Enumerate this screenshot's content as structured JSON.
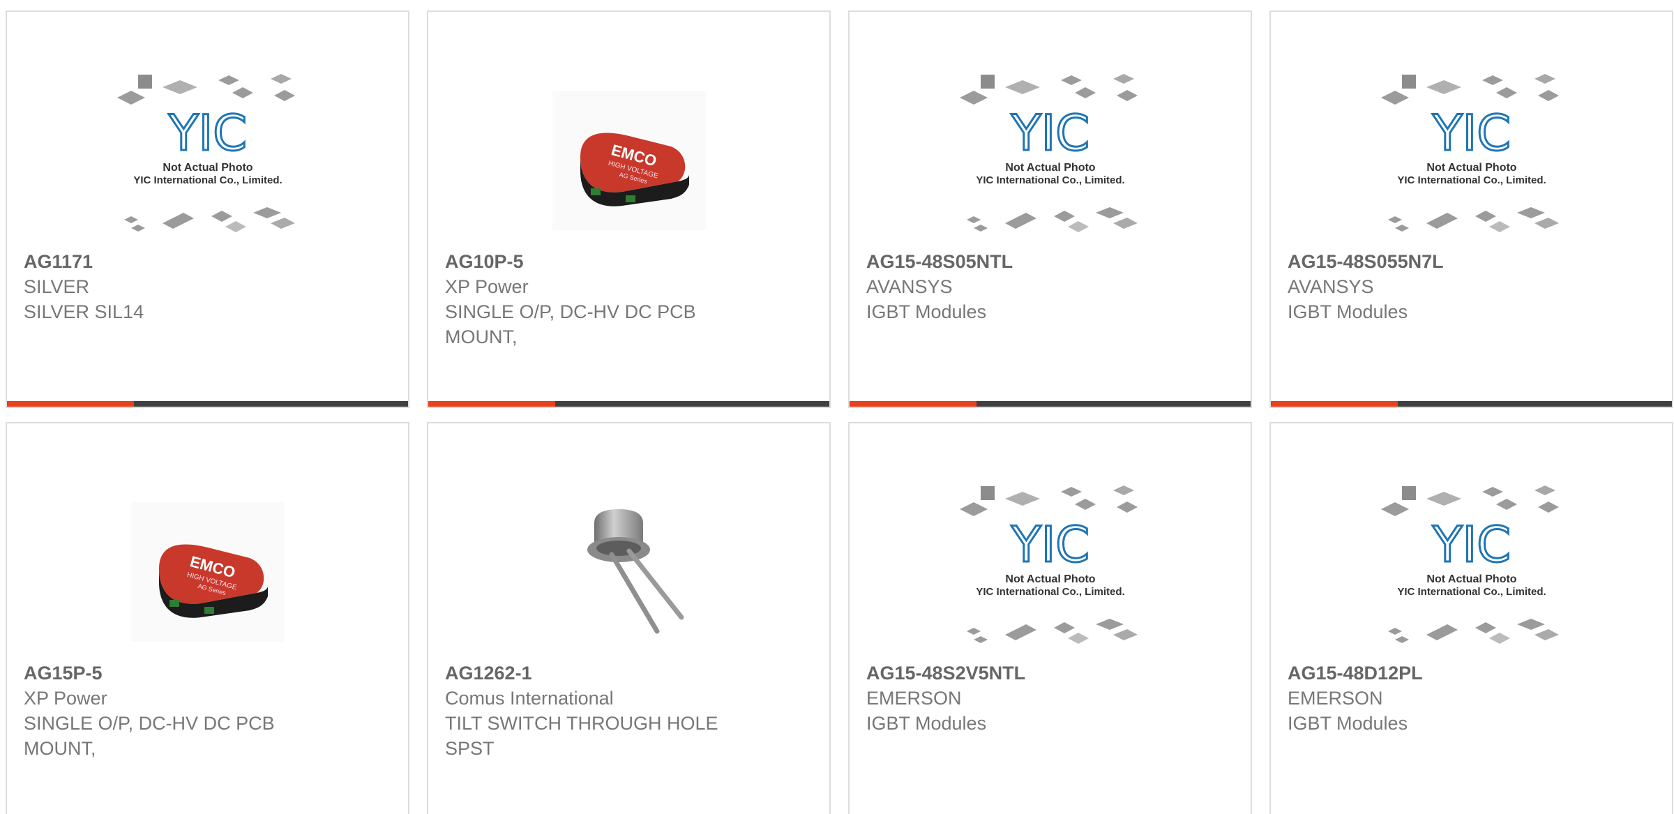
{
  "colors": {
    "accent": "#e8411c",
    "bar": "#404040",
    "card_border": "#dddddd",
    "text": "#777777"
  },
  "placeholder": {
    "logo_text": "YIC",
    "line1": "Not Actual Photo",
    "line2": "YIC International Co., Limited."
  },
  "products": [
    {
      "part_number": "AG1171",
      "manufacturer": "SILVER",
      "description": "SILVER SIL14",
      "image": "placeholder"
    },
    {
      "part_number": "AG10P-5",
      "manufacturer": "XP Power",
      "description": "SINGLE O/P, DC-HV DC PCB MOUNT,",
      "image": "emco-module"
    },
    {
      "part_number": "AG15-48S05NTL",
      "manufacturer": "AVANSYS",
      "description": "IGBT Modules",
      "image": "placeholder"
    },
    {
      "part_number": "AG15-48S055N7L",
      "manufacturer": "AVANSYS",
      "description": "IGBT Modules",
      "image": "placeholder"
    },
    {
      "part_number": "AG15P-5",
      "manufacturer": "XP Power",
      "description": "SINGLE O/P, DC-HV DC PCB MOUNT,",
      "image": "emco-module"
    },
    {
      "part_number": "AG1262-1",
      "manufacturer": "Comus International",
      "description": "TILT SWITCH THROUGH HOLE SPST",
      "image": "tilt-switch"
    },
    {
      "part_number": "AG15-48S2V5NTL",
      "manufacturer": "EMERSON",
      "description": "IGBT Modules",
      "image": "placeholder"
    },
    {
      "part_number": "AG15-48D12PL",
      "manufacturer": "EMERSON",
      "description": "IGBT Modules",
      "image": "placeholder"
    }
  ],
  "emco_label": {
    "brand": "EMCO",
    "line2": "HIGH VOLTAGE",
    "line3": "AG Series"
  }
}
